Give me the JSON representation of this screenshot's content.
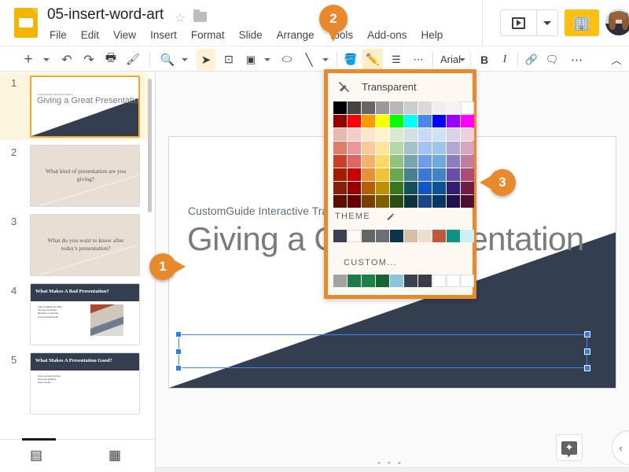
{
  "app": {
    "doc_title": "05-insert-word-art",
    "doc_icon": "slides-icon",
    "star_icon": "☆",
    "folder_icon": "folder-icon"
  },
  "menubar": {
    "items": [
      {
        "label": "File"
      },
      {
        "label": "Edit"
      },
      {
        "label": "View"
      },
      {
        "label": "Insert"
      },
      {
        "label": "Format"
      },
      {
        "label": "Slide"
      },
      {
        "label": "Arrange"
      },
      {
        "label": "Tools"
      },
      {
        "label": "Add-ons"
      },
      {
        "label": "Help"
      }
    ]
  },
  "topright": {
    "present_label": "▶",
    "present_dropdown": "▾",
    "app_button_glyph": "🏢",
    "avatar_name": "user-avatar"
  },
  "toolbar": {
    "items": [
      {
        "name": "new-slide-button",
        "glyph": "+"
      },
      {
        "name": "new-slide-dropdown",
        "glyph": "▾"
      },
      {
        "name": "undo-button",
        "glyph": "↶"
      },
      {
        "name": "redo-button",
        "glyph": "↷"
      },
      {
        "name": "print-button",
        "glyph": "🖶"
      },
      {
        "name": "paint-format-button",
        "glyph": "⌫"
      },
      {
        "name": "zoom-button",
        "glyph": "🔍"
      },
      {
        "name": "zoom-dropdown",
        "glyph": "▾"
      },
      {
        "name": "select-tool-button",
        "glyph": "➤"
      },
      {
        "name": "text-box-button",
        "glyph": "T"
      },
      {
        "name": "image-button",
        "glyph": "▣"
      },
      {
        "name": "image-dropdown",
        "glyph": "▾"
      },
      {
        "name": "shape-button",
        "glyph": "◯"
      },
      {
        "name": "line-button",
        "glyph": "╲"
      },
      {
        "name": "line-dropdown",
        "glyph": "▾"
      },
      {
        "name": "fill-color-button",
        "glyph": "🪣"
      },
      {
        "name": "border-color-button",
        "glyph": "✏"
      },
      {
        "name": "border-weight-button",
        "glyph": "≡"
      },
      {
        "name": "border-dash-button",
        "glyph": "⋯"
      }
    ],
    "font_name": "Arial",
    "font_dropdown": "▾",
    "bold_label": "B",
    "italic_label": "I",
    "link_label": "🔗",
    "comment_label": "＋",
    "more_label": "⋯",
    "collapse_label": "︿"
  },
  "filmstrip": {
    "slides": [
      {
        "number": "1",
        "title": "Giving a Great Presentation",
        "subtitle": "CustomGuide Interactive Training",
        "layout": "title-diagonal",
        "selected": true
      },
      {
        "number": "2",
        "title": "What kind of presentation are you giving?",
        "layout": "beige-center",
        "selected": false
      },
      {
        "number": "3",
        "title": "What do you want to know after today's presentation?",
        "layout": "beige-center",
        "selected": false
      },
      {
        "number": "4",
        "title": "What Makes A Bad Presentation?",
        "layout": "header-bullets-image",
        "selected": false,
        "bullets": [
          "Lack of reading your slides",
          "Too long, far off base",
          "Monotone or voice low",
          "Lots of technical words"
        ]
      },
      {
        "number": "5",
        "title": "What Makes A Presentation Good?",
        "layout": "header-bullets",
        "selected": false,
        "bullets": [
          "Know your topic and why",
          "Know your audience",
          "Keep it simple"
        ]
      }
    ],
    "footer": {
      "filmstrip_view_icon": "filmstrip-view-icon",
      "grid_view_icon": "grid-view-icon"
    }
  },
  "canvas": {
    "slide_subtitle": "CustomGuide Interactive Training",
    "slide_title": "Giving a Great Presentation",
    "explore_label": "explore-icon",
    "sidepanel_toggle": "‹",
    "scroll_dots": "• • •"
  },
  "color_picker": {
    "transparent_label": "Transparent",
    "transparent_icon": "no-color-pencil-icon",
    "theme_label": "THEME",
    "theme_edit_icon": "pencil-icon",
    "custom_label": "CUSTOM...",
    "standard_colors": [
      [
        "#000000",
        "#434343",
        "#666666",
        "#999999",
        "#b7b7b7",
        "#cccccc",
        "#d9d9d9",
        "#efefef",
        "#f3f3f3",
        "#ffffff"
      ],
      [
        "#980000",
        "#ff0000",
        "#ff9900",
        "#ffff00",
        "#00ff00",
        "#00ffff",
        "#4a86e8",
        "#0000ff",
        "#9900ff",
        "#ff00ff"
      ],
      [
        "#e6b8af",
        "#f4cccc",
        "#fce5cd",
        "#fff2cc",
        "#d9ead3",
        "#d0e0e3",
        "#c9daf8",
        "#cfe2f3",
        "#d9d2e9",
        "#ead1dc"
      ],
      [
        "#dd7e6b",
        "#ea9999",
        "#f9cb9c",
        "#ffe599",
        "#b6d7a8",
        "#a2c4c9",
        "#a4c2f4",
        "#9fc5e8",
        "#b4a7d6",
        "#d5a6bd"
      ],
      [
        "#cc4125",
        "#e06666",
        "#f6b26b",
        "#ffd966",
        "#93c47d",
        "#76a5af",
        "#6d9eeb",
        "#6fa8dc",
        "#8e7cc3",
        "#c27ba0"
      ],
      [
        "#a61c00",
        "#cc0000",
        "#e69138",
        "#f1c232",
        "#6aa84f",
        "#45818e",
        "#3c78d8",
        "#3d85c6",
        "#674ea7",
        "#a64d79"
      ],
      [
        "#85200c",
        "#990000",
        "#b45f06",
        "#bf9000",
        "#38761d",
        "#134f5c",
        "#1155cc",
        "#0b5394",
        "#351c75",
        "#741b47"
      ],
      [
        "#5b0f00",
        "#660000",
        "#783f04",
        "#7f6000",
        "#274e13",
        "#0c343d",
        "#1c4587",
        "#073763",
        "#20124d",
        "#4c1130"
      ]
    ],
    "theme_colors": [
      "#3c4053",
      "",
      "#646464",
      "#6b7078",
      "#0c3449",
      "#d5bda6",
      "#ecdfd0",
      "#c0583c",
      "#0e9384",
      "#cdeef2"
    ],
    "custom_colors": [
      "#a3a3a3",
      "#1a7c47",
      "#188347",
      "#166334",
      "#8bc4dd",
      "#3c4053",
      "#3c3a47",
      "#ffffff",
      "#ffffff",
      "#ffffff"
    ]
  },
  "callouts": [
    {
      "number": "1",
      "target": "selected-title-textbox"
    },
    {
      "number": "2",
      "target": "border-color-toolbar-button"
    },
    {
      "number": "3",
      "target": "color-picker-panel"
    }
  ]
}
